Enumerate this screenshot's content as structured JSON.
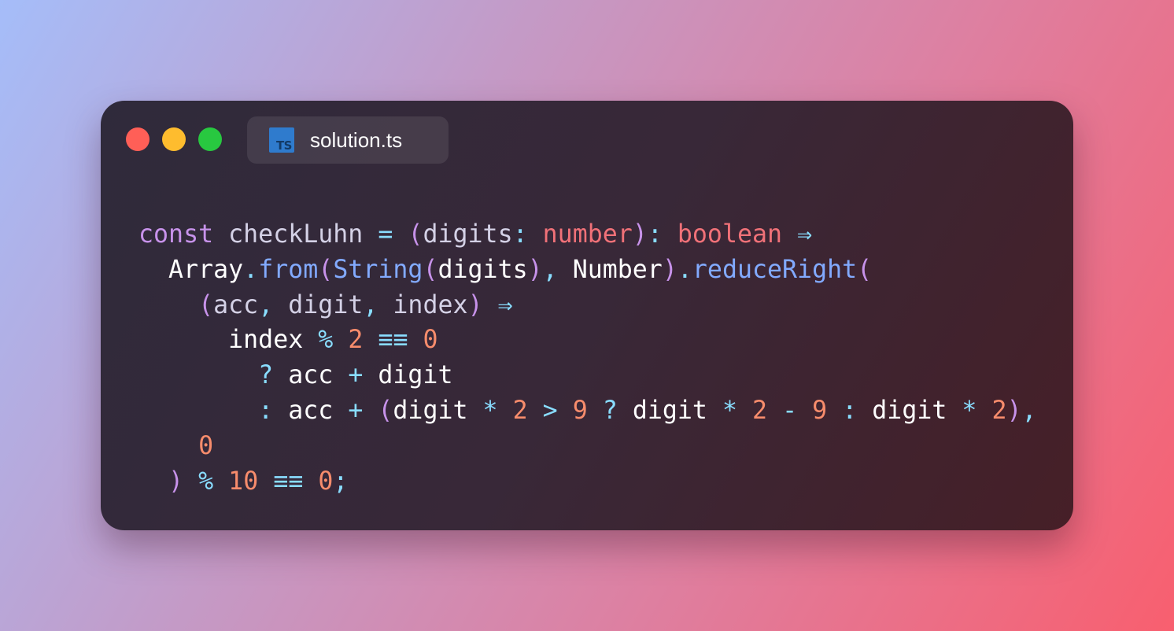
{
  "window": {
    "tab": {
      "icon_name": "typescript-file-icon",
      "icon_text": "TS",
      "label": "solution.ts"
    },
    "traffic_lights": {
      "close_color": "#ff5f57",
      "minimize_color": "#febc2e",
      "maximize_color": "#28c840"
    }
  },
  "code": {
    "language": "TypeScript",
    "lines": [
      {
        "indent": "",
        "tokens": [
          {
            "t": "keyword",
            "v": "const"
          },
          {
            "t": "plain",
            "v": " "
          },
          {
            "t": "var",
            "v": "checkLuhn"
          },
          {
            "t": "plain",
            "v": " "
          },
          {
            "t": "op",
            "v": "="
          },
          {
            "t": "plain",
            "v": " "
          },
          {
            "t": "paren",
            "v": "("
          },
          {
            "t": "param",
            "v": "digits"
          },
          {
            "t": "punct",
            "v": ": "
          },
          {
            "t": "type",
            "v": "number"
          },
          {
            "t": "paren",
            "v": ")"
          },
          {
            "t": "punct",
            "v": ": "
          },
          {
            "t": "type",
            "v": "boolean"
          },
          {
            "t": "plain",
            "v": " "
          },
          {
            "t": "op",
            "v": "⇒"
          }
        ]
      },
      {
        "indent": "  ",
        "tokens": [
          {
            "t": "plain",
            "v": "Array"
          },
          {
            "t": "punct",
            "v": "."
          },
          {
            "t": "func",
            "v": "from"
          },
          {
            "t": "paren",
            "v": "("
          },
          {
            "t": "func",
            "v": "String"
          },
          {
            "t": "paren",
            "v": "("
          },
          {
            "t": "plain",
            "v": "digits"
          },
          {
            "t": "paren",
            "v": ")"
          },
          {
            "t": "punct",
            "v": ", "
          },
          {
            "t": "plain",
            "v": "Number"
          },
          {
            "t": "paren",
            "v": ")"
          },
          {
            "t": "punct",
            "v": "."
          },
          {
            "t": "func",
            "v": "reduceRight"
          },
          {
            "t": "paren",
            "v": "("
          }
        ]
      },
      {
        "indent": "    ",
        "tokens": [
          {
            "t": "paren",
            "v": "("
          },
          {
            "t": "param",
            "v": "acc"
          },
          {
            "t": "punct",
            "v": ", "
          },
          {
            "t": "param",
            "v": "digit"
          },
          {
            "t": "punct",
            "v": ", "
          },
          {
            "t": "param",
            "v": "index"
          },
          {
            "t": "paren",
            "v": ")"
          },
          {
            "t": "plain",
            "v": " "
          },
          {
            "t": "op",
            "v": "⇒"
          }
        ]
      },
      {
        "indent": "      ",
        "tokens": [
          {
            "t": "plain",
            "v": "index"
          },
          {
            "t": "plain",
            "v": " "
          },
          {
            "t": "op",
            "v": "%"
          },
          {
            "t": "plain",
            "v": " "
          },
          {
            "t": "number",
            "v": "2"
          },
          {
            "t": "plain",
            "v": " "
          },
          {
            "t": "op",
            "v": "≡≡"
          },
          {
            "t": "plain",
            "v": " "
          },
          {
            "t": "number",
            "v": "0"
          }
        ]
      },
      {
        "indent": "        ",
        "tokens": [
          {
            "t": "op",
            "v": "?"
          },
          {
            "t": "plain",
            "v": " acc "
          },
          {
            "t": "op",
            "v": "+"
          },
          {
            "t": "plain",
            "v": " digit"
          }
        ]
      },
      {
        "indent": "        ",
        "tokens": [
          {
            "t": "op",
            "v": ":"
          },
          {
            "t": "plain",
            "v": " acc "
          },
          {
            "t": "op",
            "v": "+"
          },
          {
            "t": "plain",
            "v": " "
          },
          {
            "t": "paren",
            "v": "("
          },
          {
            "t": "plain",
            "v": "digit "
          },
          {
            "t": "op",
            "v": "*"
          },
          {
            "t": "plain",
            "v": " "
          },
          {
            "t": "number",
            "v": "2"
          },
          {
            "t": "plain",
            "v": " "
          },
          {
            "t": "op",
            "v": ">"
          },
          {
            "t": "plain",
            "v": " "
          },
          {
            "t": "number",
            "v": "9"
          },
          {
            "t": "plain",
            "v": " "
          },
          {
            "t": "op",
            "v": "?"
          },
          {
            "t": "plain",
            "v": " digit "
          },
          {
            "t": "op",
            "v": "*"
          },
          {
            "t": "plain",
            "v": " "
          },
          {
            "t": "number",
            "v": "2"
          },
          {
            "t": "plain",
            "v": " "
          },
          {
            "t": "op",
            "v": "-"
          },
          {
            "t": "plain",
            "v": " "
          },
          {
            "t": "number",
            "v": "9"
          },
          {
            "t": "plain",
            "v": " "
          },
          {
            "t": "op",
            "v": ":"
          },
          {
            "t": "plain",
            "v": " digit "
          },
          {
            "t": "op",
            "v": "*"
          },
          {
            "t": "plain",
            "v": " "
          },
          {
            "t": "number",
            "v": "2"
          },
          {
            "t": "paren",
            "v": ")"
          },
          {
            "t": "punct",
            "v": ","
          }
        ]
      },
      {
        "indent": "    ",
        "tokens": [
          {
            "t": "number",
            "v": "0"
          }
        ]
      },
      {
        "indent": "  ",
        "tokens": [
          {
            "t": "paren",
            "v": ")"
          },
          {
            "t": "plain",
            "v": " "
          },
          {
            "t": "op",
            "v": "%"
          },
          {
            "t": "plain",
            "v": " "
          },
          {
            "t": "number",
            "v": "10"
          },
          {
            "t": "plain",
            "v": " "
          },
          {
            "t": "op",
            "v": "≡≡"
          },
          {
            "t": "plain",
            "v": " "
          },
          {
            "t": "number",
            "v": "0"
          },
          {
            "t": "punct",
            "v": ";"
          }
        ]
      }
    ]
  },
  "colors": {
    "keyword": "#c792ea",
    "type": "#f07178",
    "function": "#82aaff",
    "number": "#f78c6c",
    "operator": "#89ddff",
    "text": "#ffffff"
  }
}
